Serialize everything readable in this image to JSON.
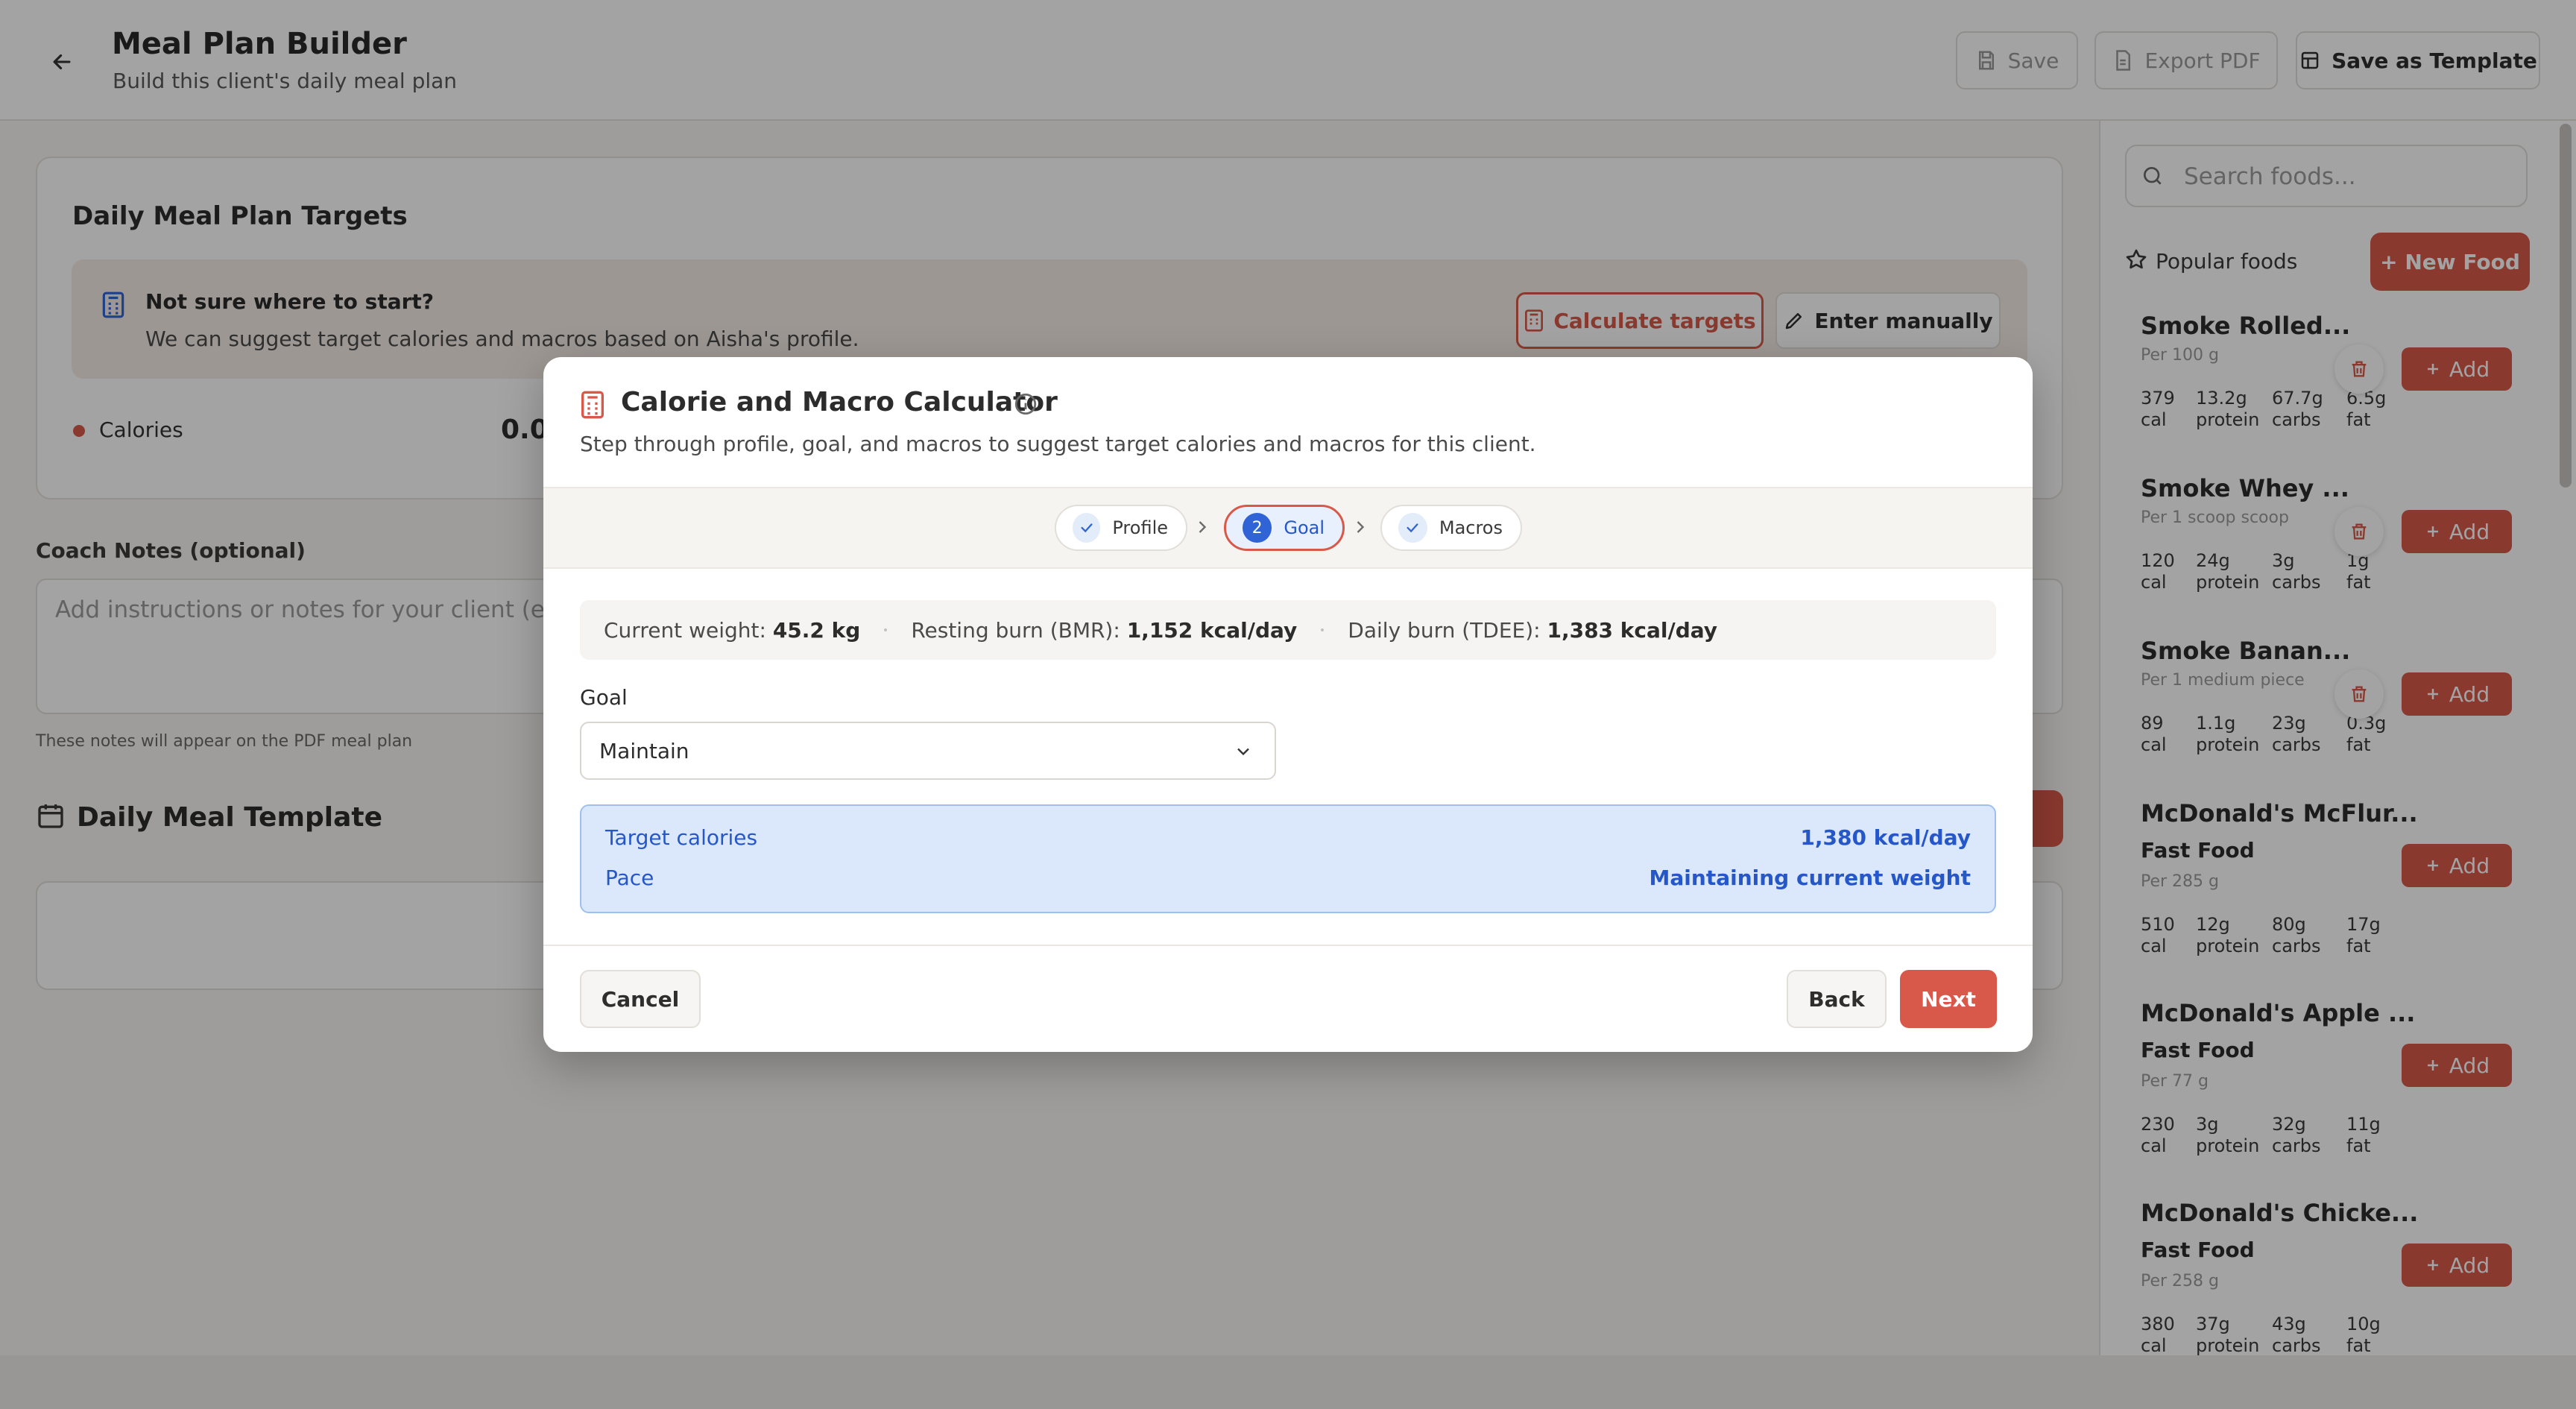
{
  "header": {
    "title": "Meal Plan Builder",
    "subtitle": "Build this client's daily meal plan",
    "save_label": "Save",
    "export_label": "Export PDF",
    "template_label": "Save as Template"
  },
  "targets": {
    "title": "Daily Meal Plan Targets",
    "hint_title": "Not sure where to start?",
    "hint_text": "We can suggest target calories and macros based on Aisha's profile.",
    "calc_label": "Calculate targets",
    "manual_label": "Enter manually",
    "calories_label": "Calories",
    "calories_value": "0.0"
  },
  "notes": {
    "label": "Coach Notes (optional)",
    "placeholder": "Add instructions or notes for your client (e.g",
    "help": "These notes will appear on the PDF meal plan"
  },
  "template": {
    "title": "Daily Meal Template"
  },
  "sidebar": {
    "search_placeholder": "Search foods...",
    "popular_label": "Popular foods",
    "new_food_label": "+ New Food",
    "add_label": "Add",
    "foods": [
      {
        "name": "Smoke Rolled...",
        "category": "",
        "per": "Per 100 g",
        "cal": "379",
        "protein": "13.2g",
        "carbs": "67.7g",
        "fat": "6.5g",
        "trash": true
      },
      {
        "name": "Smoke Whey ...",
        "category": "",
        "per": "Per 1 scoop scoop",
        "cal": "120",
        "protein": "24g",
        "carbs": "3g",
        "fat": "1g",
        "trash": true
      },
      {
        "name": "Smoke Banan...",
        "category": "",
        "per": "Per 1 medium piece",
        "cal": "89",
        "protein": "1.1g",
        "carbs": "23g",
        "fat": "0.3g",
        "trash": true
      },
      {
        "name": "McDonald's McFlur...",
        "category": "Fast Food",
        "per": "Per 285 g",
        "cal": "510",
        "protein": "12g",
        "carbs": "80g",
        "fat": "17g",
        "trash": false
      },
      {
        "name": "McDonald's Apple ...",
        "category": "Fast Food",
        "per": "Per 77 g",
        "cal": "230",
        "protein": "3g",
        "carbs": "32g",
        "fat": "11g",
        "trash": false
      },
      {
        "name": "McDonald's Chicke...",
        "category": "Fast Food",
        "per": "Per 258 g",
        "cal": "380",
        "protein": "37g",
        "carbs": "43g",
        "fat": "10g",
        "trash": false
      }
    ],
    "stat_labels": {
      "cal": "cal",
      "protein": "protein",
      "carbs": "carbs",
      "fat": "fat"
    }
  },
  "modal": {
    "title": "Calorie and Macro Calculator",
    "subtitle": "Step through profile, goal, and macros to suggest target calories and macros for this client.",
    "steps": [
      {
        "label": "Profile",
        "state": "done"
      },
      {
        "label": "Goal",
        "number": "2",
        "state": "active"
      },
      {
        "label": "Macros",
        "state": "done"
      }
    ],
    "stats": {
      "weight_label": "Current weight:",
      "weight_value": "45.2 kg",
      "bmr_label": "Resting burn (BMR):",
      "bmr_value": "1,152 kcal/day",
      "tdee_label": "Daily burn (TDEE):",
      "tdee_value": "1,383 kcal/day"
    },
    "goal_label": "Goal",
    "goal_value": "Maintain",
    "target_calories_label": "Target calories",
    "target_calories_value": "1,380 kcal/day",
    "pace_label": "Pace",
    "pace_value": "Maintaining current weight",
    "cancel_label": "Cancel",
    "back_label": "Back",
    "next_label": "Next"
  },
  "colors": {
    "accent": "#d8594a",
    "info_blue": "#2657c9",
    "info_bg": "#dbe8fb"
  }
}
